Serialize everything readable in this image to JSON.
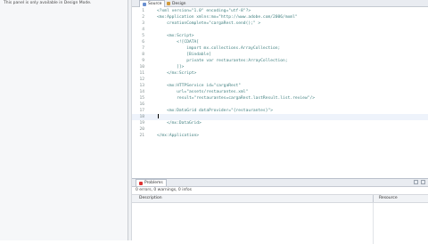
{
  "left_panel": {
    "message": "This panel is only available in Design Mode."
  },
  "editor": {
    "tabs": [
      {
        "label": "Source",
        "active": true
      },
      {
        "label": "Design",
        "active": false
      }
    ],
    "lines": [
      {
        "num": "1",
        "text": "<?xml version=\"1.0\" encoding=\"utf-8\"?>"
      },
      {
        "num": "2",
        "text": "<mx:Application xmlns:mx=\"http://www.adobe.com/2006/mxml\""
      },
      {
        "num": "3",
        "text": "    creationComplete=\"cargaRest.send();\" >"
      },
      {
        "num": "4",
        "text": ""
      },
      {
        "num": "5",
        "text": "    <mx:Script>"
      },
      {
        "num": "6",
        "text": "        <![CDATA["
      },
      {
        "num": "7",
        "text": "            import mx.collections.ArrayCollection;"
      },
      {
        "num": "8",
        "text": "            [Bindable]"
      },
      {
        "num": "9",
        "text": "            private var restaurantes:ArrayCollection;"
      },
      {
        "num": "10",
        "text": "        ]]>"
      },
      {
        "num": "11",
        "text": "    </mx:Script>"
      },
      {
        "num": "12",
        "text": ""
      },
      {
        "num": "13",
        "text": "    <mx:HTTPService id=\"cargaRest\""
      },
      {
        "num": "14",
        "text": "        url=\"assets/restaurantes.xml\""
      },
      {
        "num": "15",
        "text": "        result=\"restaurantes=cargaRest.lastResult.list.review\"/>"
      },
      {
        "num": "16",
        "text": ""
      },
      {
        "num": "17",
        "text": "    <mx:DataGrid dataProvider=\"{restaurantes}\">"
      },
      {
        "num": "18",
        "text": ""
      },
      {
        "num": "19",
        "text": "    </mx:DataGrid>"
      },
      {
        "num": "20",
        "text": ""
      },
      {
        "num": "21",
        "text": "</mx:Application>"
      }
    ],
    "current_line": "18"
  },
  "problems": {
    "tab_label": "Problems",
    "summary": "0 errors, 0 warnings, 0 infos",
    "columns": {
      "description": "Description",
      "resource": "Resource"
    },
    "accent_color": "#dd3333"
  }
}
